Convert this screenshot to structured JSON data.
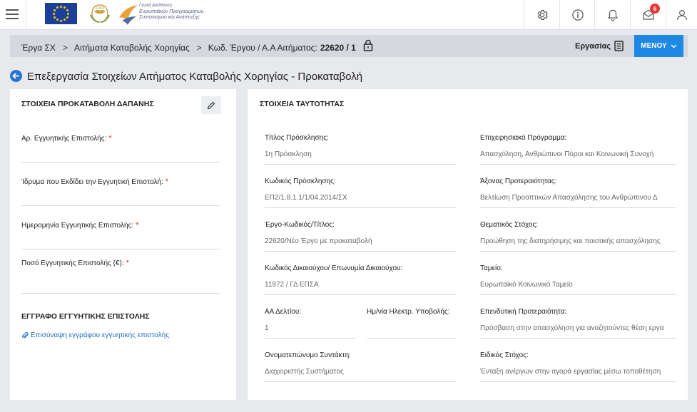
{
  "header": {
    "logo_lines": [
      "Γενική Διεύθυνση",
      "Ευρωπαϊκών Προγραμμάτων,",
      "Συντονισμού και Ανάπτυξης"
    ],
    "notification_count": "6",
    "icons": [
      "menu-icon",
      "gear-icon",
      "info-icon",
      "bell-icon",
      "mail-icon",
      "user-icon"
    ]
  },
  "breadcrumb": {
    "items": [
      "Έργα ΣΧ",
      "Αιτήματα Καταβολής Χορηγίας",
      "Κωδ. Έργου / Α.Α Αιτήματος:"
    ],
    "code": "22620 / 1",
    "work_label": "Εργασίας",
    "menu_label": "ΜΕΝΟΥ"
  },
  "page": {
    "title": "Επεξεργασία Στοιχείων Αιτήματος Καταβολής Χορηγίας - Προκαταβολή"
  },
  "left": {
    "title": "ΣΤΟΙΧΕΙΑ ΠΡΟΚΑΤΑΒΟΛΗ ΔΑΠΑΝΗΣ",
    "fields": [
      {
        "label": "Αρ. Εγγυητικής Επιστολής:",
        "req": "*"
      },
      {
        "label": "Ίδρυμα που Εκδίδει την Εγγυητική Επιστολή:",
        "req": "*"
      },
      {
        "label": "Ημερομηνία Εγγυητικής Επιστολής:",
        "req": "*"
      },
      {
        "label": "Ποσό Εγγυητικής Επιστολής (€):",
        "req": "*"
      }
    ],
    "doc_title": "ΕΓΓΡΑΦΟ ΕΓΓΥΗΤΙΚΗΣ ΕΠΙΣΤΟΛΗΣ",
    "attach_label": "Επισύναψη εγγράφου εγγυητικής επιστολής"
  },
  "right": {
    "title": "ΣΤΟΙΧΕΙΑ ΤΑΥΤΟΤΗΤΑΣ",
    "fields": [
      {
        "label": "Τίτλος Πρόσκλησης:",
        "value": "1η Πρόσκληση"
      },
      {
        "label": "Επιχειρησιακό Πρόγραμμα:",
        "value": "Απασχόληση, Ανθρώπινοι Πόροι και Κοινωνική Συνοχή"
      },
      {
        "label": "Κωδικός Πρόσκλησης:",
        "value": "ΕΠ2/1.8.1.1/1/04.2014/ΣΧ"
      },
      {
        "label": "Άξονας Προτεραιότητας:",
        "value": "Βελτίωση Προοπτικών Απασχόλησης του Ανθρώπινου Δ"
      },
      {
        "label": "Έργο-Κωδικός/Τίτλος:",
        "value": "22620/Νέο Έργο με προκαταβολή"
      },
      {
        "label": "Θεματικός Στόχος:",
        "value": "Προώθηση της διατηρήσιμης και ποιοτικής απασχόλησης"
      },
      {
        "label": "Κωδικός Δικαιούχου/ Επωνυμία Δικαιούχου:",
        "value": "11972 / ΓΔ ΕΠΣΑ"
      },
      {
        "label": "Ταμείο:",
        "value": "Ευρωπαϊκό Κοινωνικό Ταμείο"
      },
      {
        "label": "ΑΑ Δελτίου:",
        "value": "1"
      },
      {
        "label": "Ημ/νία Ηλεκτρ. Υποβολής:",
        "value": ""
      },
      {
        "label": "Επενδυτική Προτεραιότητα:",
        "value": "Πρόσβαση στην απασχόληση για αναζητούντες θέση εργα"
      },
      {
        "label": "Ονοματεπώνυμο Συντάκτη:",
        "value": "Διαχειριστής Συστήματος"
      },
      {
        "label": "Ειδικός Στόχος:",
        "value": "Ένταξη ανέργων στην αγορά εργασίας μέσω τοποθέτηση"
      }
    ]
  }
}
